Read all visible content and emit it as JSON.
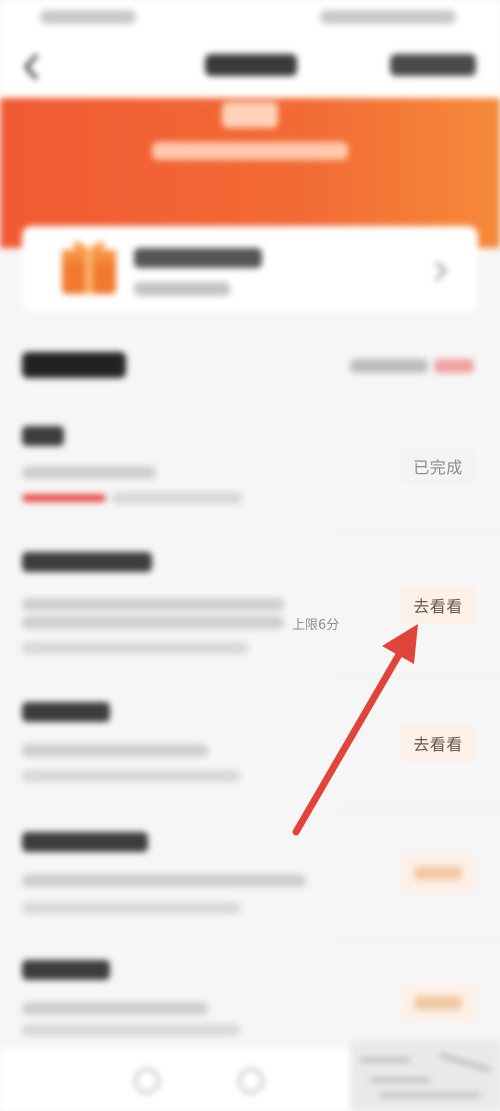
{
  "tasks": {
    "done_button": "已完成",
    "go_button": "去看看",
    "go_button_2": "去看看",
    "limit_note": "上限6分"
  },
  "icons": {
    "back": "chevron-left-icon",
    "gift": "gift-icon",
    "card_arrow": "chevron-right-icon",
    "tabs": [
      "tab-icon-1",
      "tab-icon-2"
    ]
  },
  "colors": {
    "banner": "#f15a33",
    "accent_red": "#e84d4d",
    "annotation_arrow": "#e0443a"
  }
}
